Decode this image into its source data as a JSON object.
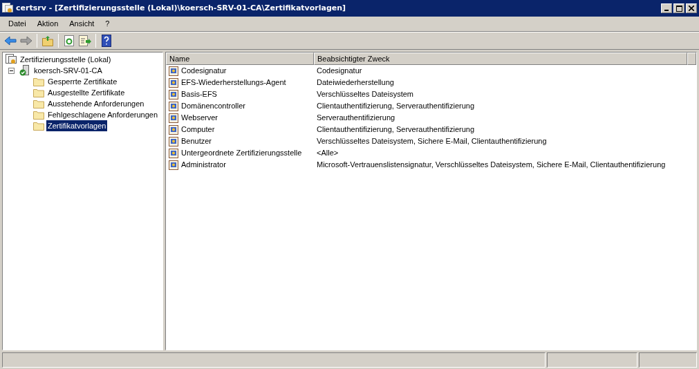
{
  "window": {
    "title": "certsrv - [Zertifizierungsstelle (Lokal)\\koersch-SRV-01-CA\\Zertifikatvorlagen]"
  },
  "menu": [
    "Datei",
    "Aktion",
    "Ansicht",
    "?"
  ],
  "toolbar": [
    {
      "kind": "back"
    },
    {
      "kind": "forward"
    },
    {
      "kind": "separator"
    },
    {
      "kind": "up"
    },
    {
      "kind": "separator"
    },
    {
      "kind": "refresh"
    },
    {
      "kind": "export"
    },
    {
      "kind": "separator"
    },
    {
      "kind": "help"
    }
  ],
  "tree": [
    {
      "label": "Zertifizierungsstelle (Lokal)",
      "kind": "root",
      "selected": false,
      "children": [
        {
          "label": "koersch-SRV-01-CA",
          "kind": "server",
          "expanded": true,
          "selected": false,
          "children": [
            {
              "label": "Gesperrte Zertifikate",
              "kind": "folder",
              "selected": false
            },
            {
              "label": "Ausgestellte Zertifikate",
              "kind": "folder",
              "selected": false
            },
            {
              "label": "Ausstehende Anforderungen",
              "kind": "folder",
              "selected": false
            },
            {
              "label": "Fehlgeschlagene Anforderungen",
              "kind": "folder",
              "selected": false
            },
            {
              "label": "Zertifikatvorlagen",
              "kind": "folder",
              "selected": true
            }
          ]
        }
      ]
    }
  ],
  "table": {
    "columns": [
      "Name",
      "Beabsichtigter Zweck"
    ],
    "rows": [
      [
        "Codesignatur",
        "Codesignatur"
      ],
      [
        "EFS-Wiederherstellungs-Agent",
        "Dateiwiederherstellung"
      ],
      [
        "Basis-EFS",
        "Verschlüsseltes Dateisystem"
      ],
      [
        "Domänencontroller",
        "Clientauthentifizierung, Serverauthentifizierung"
      ],
      [
        "Webserver",
        "Serverauthentifizierung"
      ],
      [
        "Computer",
        "Clientauthentifizierung, Serverauthentifizierung"
      ],
      [
        "Benutzer",
        "Verschlüsseltes Dateisystem, Sichere E-Mail, Clientauthentifizierung"
      ],
      [
        "Untergeordnete Zertifizierungsstelle",
        "<Alle>"
      ],
      [
        "Administrator",
        "Microsoft-Vertrauenslistensignatur, Verschlüsseltes Dateisystem, Sichere E-Mail, Clientauthentifizierung"
      ]
    ]
  }
}
